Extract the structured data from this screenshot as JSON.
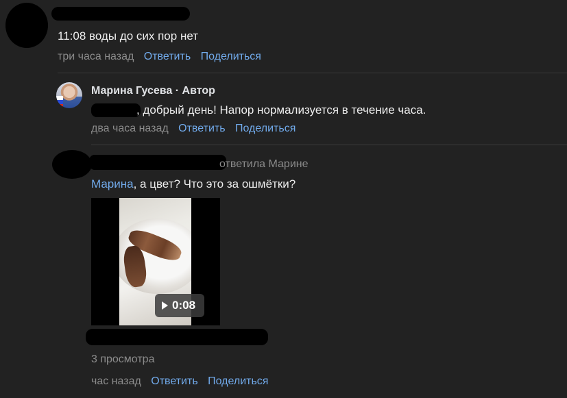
{
  "comment1": {
    "text": "11:08 воды до сих пор нет",
    "time": "три часа назад",
    "reply_label": "Ответить",
    "share_label": "Поделиться"
  },
  "reply1": {
    "author": "Марина Гусева · Автор",
    "text": ", добрый день! Напор нормализуется в течение часа.",
    "time": "два часа назад",
    "reply_label": "Ответить",
    "share_label": "Поделиться"
  },
  "reply2": {
    "replied_to": "ответила Марине",
    "mention": "Марина",
    "text": ", а цвет? Что это за ошмётки?",
    "video_duration": "0:08",
    "views": "3 просмотра",
    "time": "час назад",
    "reply_label": "Ответить",
    "share_label": "Поделиться"
  },
  "colors": {
    "background": "#222222",
    "link": "#71aaeb",
    "muted": "#8b8b8b",
    "text": "#ededed"
  }
}
